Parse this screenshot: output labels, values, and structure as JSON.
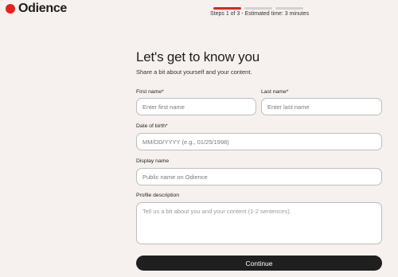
{
  "brand": {
    "name": "Odience",
    "dot_color": "#e8211c"
  },
  "progress": {
    "current_step": 1,
    "total_steps": 3,
    "text": "Steps 1 of 3 - Estimated time: 3 minutes"
  },
  "form": {
    "title": "Let's get to know you",
    "subtitle": "Share a bit about yourself and your content.",
    "first_name": {
      "label": "First name*",
      "placeholder": "Enter first name",
      "value": ""
    },
    "last_name": {
      "label": "Last name*",
      "placeholder": "Enter last name",
      "value": ""
    },
    "date_of_birth": {
      "label": "Date of birth*",
      "placeholder": "MM/DD/YYYY (e.g., 01/25/1998)",
      "value": ""
    },
    "display_name": {
      "label": "Display name",
      "placeholder": "Public name on Odience",
      "value": ""
    },
    "profile_description": {
      "label": "Profile description",
      "placeholder": "Tell us a bit about you and your content (1-2 sentences).",
      "value": ""
    },
    "continue_label": "Continue"
  }
}
